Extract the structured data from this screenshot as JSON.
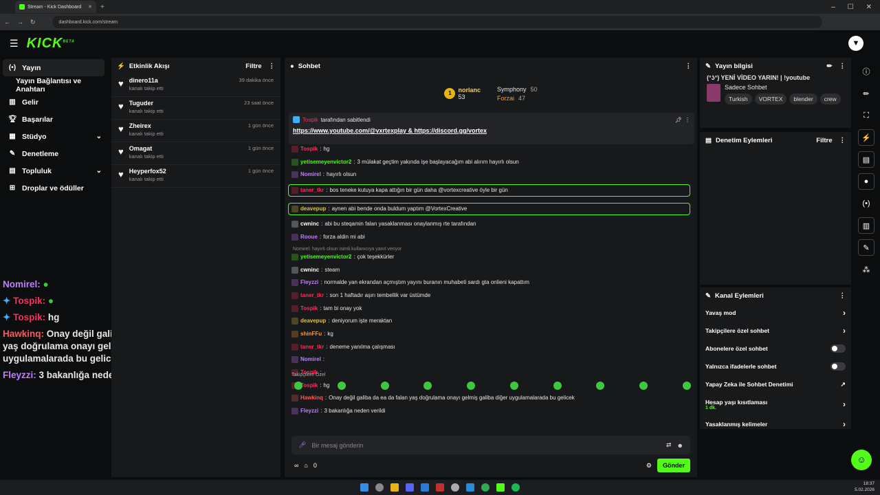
{
  "browser": {
    "tab_title": "Stream - Kick Dashboard",
    "url": "dashboard.kick.com/stream"
  },
  "brand": {
    "logo": "KICK",
    "beta": "BETA",
    "accent": "#53fc18"
  },
  "sidebar": {
    "items": [
      {
        "label": "Yayın",
        "icon": "broadcast-icon"
      },
      {
        "label": "Yayın Bağlantısı ve Anahtarı"
      },
      {
        "label": "Gelir",
        "icon": "chart-icon"
      },
      {
        "label": "Başarılar",
        "icon": "trophy-icon"
      },
      {
        "label": "Stüdyo",
        "icon": "studio-icon"
      },
      {
        "label": "Denetleme",
        "icon": "wrench-icon"
      },
      {
        "label": "Topluluk",
        "icon": "community-icon"
      },
      {
        "label": "Droplar ve ödüller",
        "icon": "gift-icon"
      }
    ]
  },
  "overlay_chat": [
    {
      "user": "Nomirel:",
      "text": ""
    },
    {
      "user": "Tospik:",
      "text": ""
    },
    {
      "user": "Tospik:",
      "text": "hg"
    },
    {
      "user": "Hawkinq:",
      "text": "Onay değil galiba da ea da falan yaş doğrulama onayı gelmiş galiba diğer uygulamalarada bu gelicek"
    },
    {
      "user": "Fleyzzi:",
      "text": "3 bakanlığa neden verildi"
    }
  ],
  "activity": {
    "title": "Etkinlik Akışı",
    "filter": "Filtre",
    "items": [
      {
        "name": "dinero11a",
        "sub": "kanalı takip etti",
        "time": "39 dakika önce"
      },
      {
        "name": "Tuguder",
        "sub": "kanalı takip etti",
        "time": "23 saat önce"
      },
      {
        "name": "Zheirex",
        "sub": "kanalı takip etti",
        "time": "1 gün önce"
      },
      {
        "name": "Omagat",
        "sub": "kanalı takip etti",
        "time": "1 gün önce"
      },
      {
        "name": "Heyperfox52",
        "sub": "kanalı takip etti",
        "time": "1 gün önce"
      }
    ]
  },
  "chat": {
    "title": "Sohbet",
    "leaders": [
      {
        "name": "norlanc",
        "value": "53"
      },
      {
        "name": "Symphony",
        "value": "50"
      },
      {
        "name": "Forzai",
        "value": "47"
      }
    ],
    "pinned_by": "tarafından sabitlendi",
    "pinned_user": "Tospik",
    "pinned_link": "https://www.youtube.com/@vxrtexplay & https://discord.gg/vortex",
    "reply_note": "Nomirel: hayırlı olsun isimli kullanıcıya yanıt veriyor",
    "messages": [
      {
        "user": "Tospik",
        "color": "#ff2e5b",
        "text": "hg"
      },
      {
        "user": "yetisemeyenvictor2",
        "color": "#53fc18",
        "text": "3 mülakat geçtim yakında işe başlayacağım abi alırım hayırlı olsun"
      },
      {
        "user": "Nomirel",
        "color": "#c57cff",
        "text": "hayırlı olsun"
      },
      {
        "user": "taner_tkr",
        "color": "#ff2e5b",
        "text": "bos teneke kutuya kapa attığın bir gün daha @vortexcreative öyle bir gün"
      },
      {
        "user": "deavepup",
        "color": "#e0c040",
        "text": "aynen abi bende onda buldum yaptım @VortexCreative"
      },
      {
        "user": "cwninc",
        "color": "#ffffff",
        "text": "abi bu steqamin falan yasaklanması onaylanmış rte tarafından"
      },
      {
        "user": "Rooue",
        "color": "#c57cff",
        "text": "forza aldin mi abi"
      },
      {
        "user": "yetisemeyenvictor2",
        "color": "#53fc18",
        "text": "çok teşekkürler"
      },
      {
        "user": "cwninc",
        "color": "#ffffff",
        "text": "steam"
      },
      {
        "user": "Fleyzzi",
        "color": "#c57cff",
        "text": "normalde yan ekrandan açmıştım yayını buranın muhabeti sardı gta onlieni kapattım"
      },
      {
        "user": "taner_tkr",
        "color": "#ff2e5b",
        "text": "son 1 haftadır aşırı tembellik var üstümde"
      },
      {
        "user": "Tospik",
        "color": "#ff2e5b",
        "text": "tam bi onay yok"
      },
      {
        "user": "deavepup",
        "color": "#e0c040",
        "text": "deniyorum işte meraktan"
      },
      {
        "user": "shinFFu",
        "color": "#ff9a2e",
        "text": "kg"
      },
      {
        "user": "taner_tkr",
        "color": "#ff2e5b",
        "text": "deneme yanılma çalışması"
      },
      {
        "user": "Nomirel",
        "color": "#c57cff",
        "text": ""
      },
      {
        "user": "Tospik",
        "color": "#ff2e5b",
        "text": ""
      },
      {
        "user": "Tospik",
        "color": "#ff2e5b",
        "text": "hg"
      },
      {
        "user": "Hawkinq",
        "color": "#ff5a5a",
        "text": "Onay değil galiba da ea da falan yaş doğrulama onayı gelmiş galiba diğer uygulamalarada bu gelicek"
      },
      {
        "user": "Fleyzzi",
        "color": "#c57cff",
        "text": "3 bakanlığa neden verildi"
      }
    ],
    "emote_label": "Takipçilere Özel",
    "input_placeholder": "Bir mesaj gönderin",
    "counter": "0",
    "send": "Gönder"
  },
  "stream_info": {
    "title": "Yayın bilgisi",
    "stream_title": "(°ʖ°) YENİ VİDEO YARIN! | !youtube",
    "category": "Sadece Sohbet",
    "tags": [
      "Turkish",
      "VORTEX",
      "blender",
      "crew"
    ]
  },
  "mod_actions": {
    "title": "Denetim Eylemleri",
    "filter": "Filtre"
  },
  "channel_actions": {
    "title": "Kanal Eylemleri",
    "items": [
      {
        "label": "Yavaş mod",
        "type": "arrow"
      },
      {
        "label": "Takipçilere özel sohbet",
        "type": "arrow"
      },
      {
        "label": "Abonelere özel sohbet",
        "type": "toggle"
      },
      {
        "label": "Yalnızca ifadelerle sohbet",
        "type": "toggle"
      },
      {
        "label": "Yapay Zeka ile Sohbet Denetimi",
        "type": "ext"
      },
      {
        "label": "Hesap yaşı kısıtlaması",
        "sub": "1 dk.",
        "type": "arrow"
      },
      {
        "label": "Yasaklanmış kelimeler",
        "type": "arrow"
      }
    ]
  },
  "clock": {
    "time": "18:37",
    "date": "5.02.2026"
  }
}
